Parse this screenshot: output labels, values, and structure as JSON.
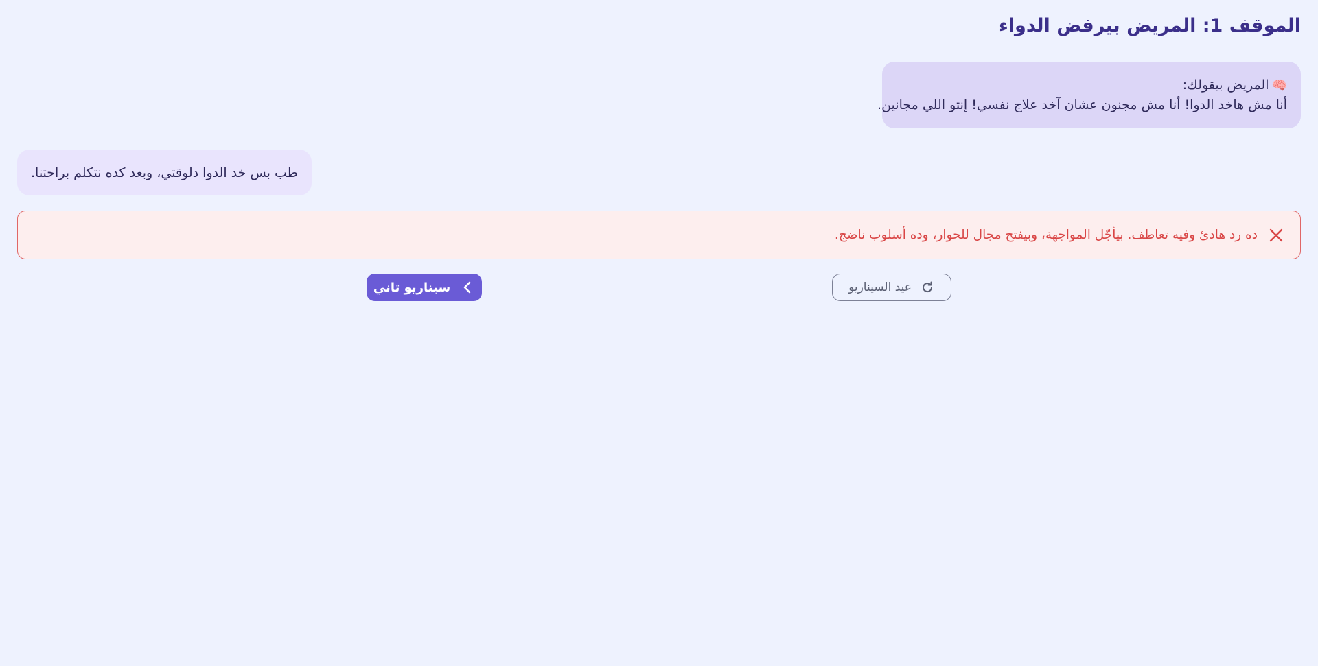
{
  "scenario": {
    "title": "الموقف 1: المريض بيرفض الدواء"
  },
  "patient_message": {
    "icon": "brain-icon",
    "header": "المريض بيقولك:",
    "text": "أنا مش هاخد الدوا! أنا مش مجنون عشان آخد علاج نفسي! إنتو اللي مجانين."
  },
  "response_message": {
    "text": "طب بس خد الدوا دلوقتي، وبعد كده نتكلم براحتنا."
  },
  "feedback": {
    "status": "incorrect",
    "icon": "close-icon",
    "text": "ده رد هادئ وفيه تعاطف. بيأجّل المواجهة، وبيفتح مجال للحوار، وده أسلوب ناضج.",
    "color": "#d94646"
  },
  "actions": {
    "retry_label": "عيد السيناريو",
    "next_label": "سيناريو تاني"
  },
  "colors": {
    "background": "#eef2fe",
    "accent": "#6a5bd6",
    "title": "#3b2f8a",
    "patient_bubble": "#dcd6f7",
    "response_bubble": "#e9e4fd",
    "error_border": "#e06767",
    "error_background": "#fdeeee"
  }
}
